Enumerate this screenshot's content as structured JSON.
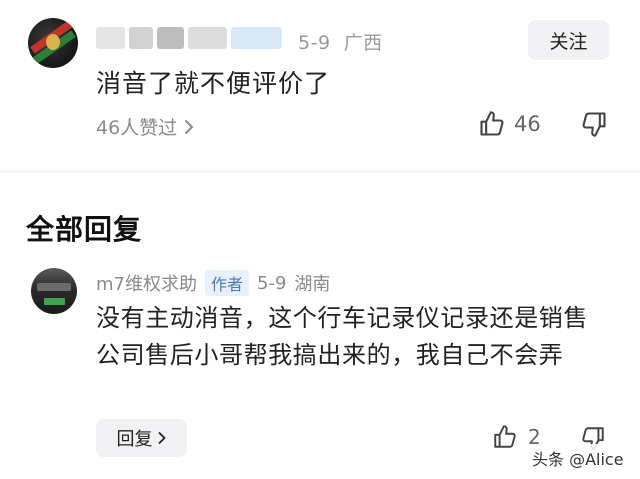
{
  "top_comment": {
    "username": "",
    "date": "5-9",
    "location": "广西",
    "follow_label": "关注",
    "text": "消音了就不便评价了",
    "likes_link": "46人赞过",
    "like_count": "46",
    "icons": {
      "like": "thumbs-up-icon",
      "dislike": "thumbs-down-icon",
      "chevron": "chevron-right-icon"
    }
  },
  "section": {
    "title": "全部回复"
  },
  "reply": {
    "username": "m7维权求助",
    "author_tag": "作者",
    "date": "5-9",
    "location": "湖南",
    "text": "没有主动消音，这个行车记录仪记录还是销售公司售后小哥帮我搞出来的，我自己不会弄",
    "reply_label": "回复",
    "like_count": "2"
  },
  "watermark": "头条 @Alice",
  "colors": {
    "accent_tag_bg": "#e8f1fb",
    "accent_tag_text": "#4a7ab5",
    "button_bg": "#f1f1f3"
  }
}
